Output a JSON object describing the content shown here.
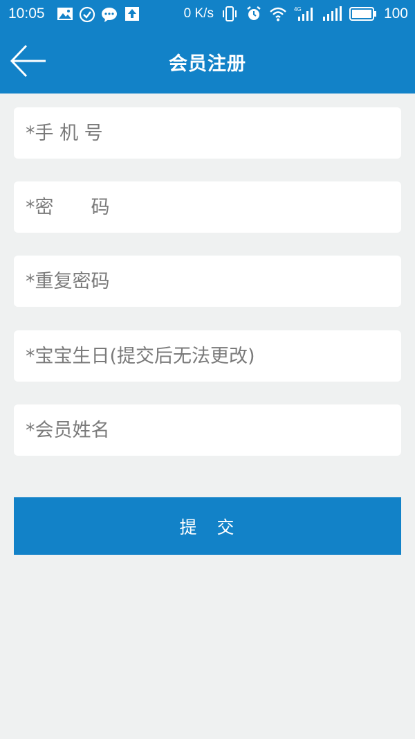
{
  "status_bar": {
    "time": "10:05",
    "net_speed": "0 K/s",
    "battery_level": "100",
    "left_icons": [
      "image-icon",
      "check-circle-icon",
      "wechat-icon",
      "upload-icon"
    ],
    "right_icons": [
      "vibrate-icon",
      "alarm-icon",
      "wifi-icon",
      "signal-4g-icon",
      "signal-icon",
      "battery-icon"
    ]
  },
  "header": {
    "title": "会员注册",
    "back_icon": "back-arrow-icon"
  },
  "form": {
    "phone_placeholder": "*手 机 号",
    "password_placeholder": "*密　　码",
    "confirm_password_placeholder": "*重复密码",
    "baby_birthday_placeholder": "*宝宝生日(提交后无法更改)",
    "member_name_placeholder": "*会员姓名",
    "submit_label": "提　交"
  },
  "colors": {
    "primary": "#1282c8",
    "background": "#eff1f1",
    "field_background": "#ffffff",
    "placeholder_text": "#7a7a7a"
  }
}
